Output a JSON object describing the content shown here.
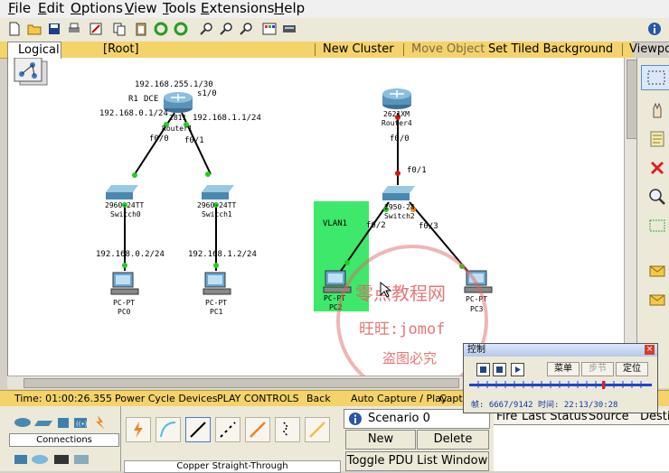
{
  "menu": [
    "File",
    "Edit",
    "Options",
    "View",
    "Tools",
    "Extensions",
    "Help"
  ],
  "menu_accel": [
    "F",
    "E",
    "O",
    "V",
    "T",
    "E",
    "H"
  ],
  "menu_rest": [
    "ile",
    "dit",
    "ptions",
    "iew",
    "ools",
    "xtensions",
    "elp"
  ],
  "toolbar": {
    "info_icon": "info-icon"
  },
  "topbar": {
    "logical": "Logical",
    "root": "[Root]",
    "new_cluster": "New Cluster",
    "move_object": "Move Object",
    "set_tiled_bg": "Set Tiled Background",
    "viewport": "Viewpo"
  },
  "topology": {
    "router1": {
      "name": "Router1",
      "model": "2811",
      "ip_top": "192.168.255.1/30",
      "r1": "R1",
      "dce": "DCE",
      "s10": "s1/0",
      "ip_left": "192.168.0.1/24",
      "ip_right": "192.168.1.1/24",
      "f00": "f0/0",
      "f01": "f0/1"
    },
    "router4": {
      "name": "Router4",
      "model": "2621XM",
      "f00": "f0/0"
    },
    "switch0": {
      "name": "Switch0",
      "model": "2960-24TT"
    },
    "switch1": {
      "name": "Switch1",
      "model": "2960-24TT"
    },
    "switch2": {
      "name": "Switch2",
      "model": "2950-24",
      "f01": "f0/1",
      "f02": "f0/2",
      "f03": "f0/3"
    },
    "pc0": {
      "name": "PC0",
      "model": "PC-PT",
      "ip": "192.168.0.2/24"
    },
    "pc1": {
      "name": "PC1",
      "model": "PC-PT",
      "ip": "192.168.1.2/24"
    },
    "pc2": {
      "name": "PC2",
      "model": "PC-PT"
    },
    "pc3": {
      "name": "PC3",
      "model": "PC-PT"
    },
    "vlan": "VLAN1",
    "colors": {
      "vlan_fill": "#3ee86a",
      "link_green": "#22cc22",
      "link_red": "#dd1111",
      "link_orange": "#ff8800"
    }
  },
  "watermark": {
    "line1": "零点教程网",
    "line2": "旺旺:jomof",
    "line3": "盗图必究",
    "color": "#e06060"
  },
  "control": {
    "title": "控制",
    "menu": "菜单",
    "step": "步节",
    "locate": "定位",
    "status": "帧: 6667/9142 时间: 22:13/30:28",
    "progress": 0.729
  },
  "status": {
    "time": "Time: 01:00:26.355",
    "power": "Power Cycle Devices",
    "play": "PLAY CONTROLS",
    "back": "Back",
    "auto": "Auto Capture / Play",
    "capture": "Captu"
  },
  "bottom": {
    "connections": "Connections",
    "cable": "Copper Straight-Through",
    "scenario": "Scenario 0",
    "new": "New",
    "delete": "Delete",
    "toggle": "Toggle PDU List Window",
    "columns": [
      "Fire",
      "Last Status",
      "Source",
      "Desti"
    ]
  }
}
